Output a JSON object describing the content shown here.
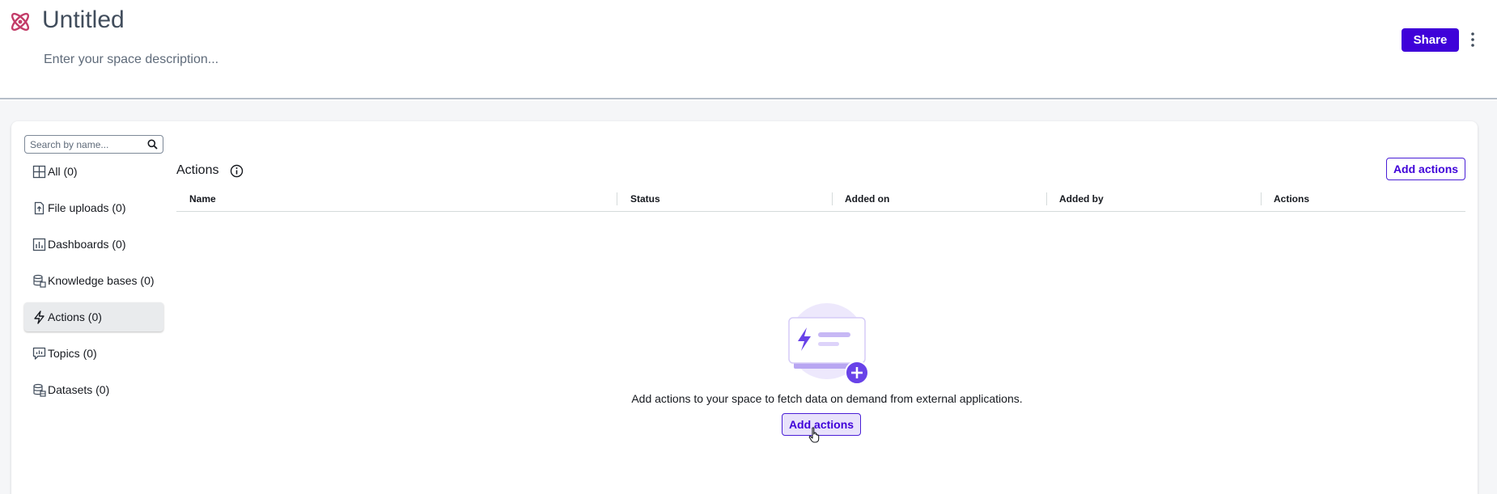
{
  "header": {
    "title": "Untitled",
    "description_placeholder": "Enter your space description...",
    "share_label": "Share",
    "brand_color": "#3f02d9",
    "logo_icon": "atom-icon"
  },
  "sidebar": {
    "search_placeholder": "Search by name...",
    "items": [
      {
        "label": "All (0)",
        "icon": "grid-icon"
      },
      {
        "label": "File uploads (0)",
        "icon": "file-upload-icon"
      },
      {
        "label": "Dashboards (0)",
        "icon": "dashboard-icon"
      },
      {
        "label": "Knowledge bases (0)",
        "icon": "database-icon"
      },
      {
        "label": "Actions (0)",
        "icon": "lightning-icon",
        "active": true
      },
      {
        "label": "Topics (0)",
        "icon": "topic-icon"
      },
      {
        "label": "Datasets (0)",
        "icon": "dataset-icon"
      }
    ]
  },
  "main": {
    "section_title": "Actions",
    "add_actions_label": "Add actions",
    "columns": [
      "Name",
      "Status",
      "Added on",
      "Added by",
      "Actions"
    ],
    "empty_message": "Add actions to your space to fetch data on demand from external applications.",
    "empty_button_label": "Add actions"
  }
}
